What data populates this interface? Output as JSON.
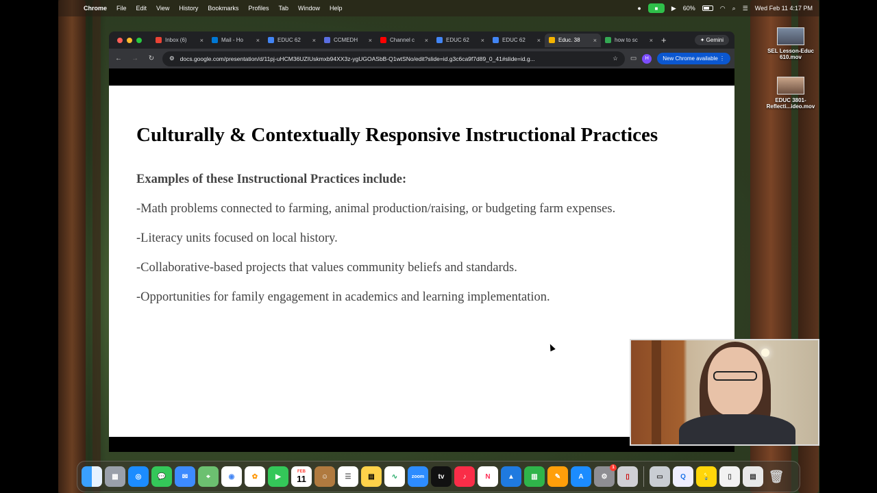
{
  "menubar": {
    "app_name": "Chrome",
    "menus": [
      "File",
      "Edit",
      "View",
      "History",
      "Bookmarks",
      "Profiles",
      "Tab",
      "Window",
      "Help"
    ],
    "battery": "60%",
    "datetime": "Wed Feb 11  4:17 PM"
  },
  "desktop_files": [
    {
      "label": "SEL Lesson-Educ 610.mov"
    },
    {
      "label": "EDUC 3801-Reflecti...ideo.mov"
    }
  ],
  "browser": {
    "tabs": [
      {
        "label": "Inbox (6)",
        "color": "#ea4335"
      },
      {
        "label": "Mail - Ho",
        "color": "#0078d4"
      },
      {
        "label": "EDUC 62",
        "color": "#4285f4"
      },
      {
        "label": "CCMEDH",
        "color": "#5a6ee0"
      },
      {
        "label": "Channel c",
        "color": "#ff0000"
      },
      {
        "label": "EDUC 62",
        "color": "#4285f4"
      },
      {
        "label": "EDUC 62",
        "color": "#4285f4"
      },
      {
        "label": "Educ. 38",
        "color": "#f4b400",
        "active": true
      },
      {
        "label": "how to sc",
        "color": "#34a853"
      }
    ],
    "gemini_label": "Gemini",
    "url": "docs.google.com/presentation/d/11pj-uHCM36UZIUskmxb94XX3z-ygUGOASbB-Q1wtSNo/edit?slide=id.g3c6ca9f7d89_0_41#slide=id.g...",
    "profile_initial": "H",
    "update_label": "New Chrome available"
  },
  "slide": {
    "title": "Culturally & Contextually Responsive Instructional Practices",
    "subtitle": "Examples of these Instructional Practices include:",
    "lines": [
      "-Math problems connected to farming, animal production/raising, or budgeting farm expenses.",
      "-Literacy units focused on local history.",
      "-Collaborative-based projects that values community beliefs and standards.",
      "-Opportunities for family engagement in academics and learning implementation."
    ]
  },
  "dock": {
    "calendar_month": "FEB",
    "calendar_day": "11",
    "settings_badge": "1",
    "zoom_label": "zoom",
    "tv_label": "tv"
  }
}
